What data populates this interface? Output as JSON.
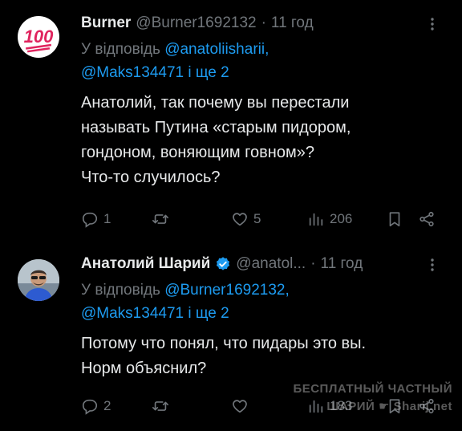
{
  "tweets": [
    {
      "name": "Burner",
      "handle": "@Burner1692132",
      "separator": "·",
      "time": "11 год",
      "avatar_text": "100",
      "reply_prefix": "У відповідь",
      "reply_mention1": "@anatoliisharii,",
      "reply_mention2": "@Maks134471",
      "reply_suffix": "і ще 2",
      "text_lines": [
        "Анатолий, так почему вы перестали",
        "называть Путина «старым пидором,",
        "гондоном, воняющим говном»?",
        "Что-то случилось?"
      ],
      "replies": "1",
      "retweets": "",
      "likes": "5",
      "views": "206"
    },
    {
      "name": "Анатолий Шарий",
      "handle": "@anatol...",
      "separator": "·",
      "time": "11 год",
      "verified": true,
      "reply_prefix": "У відповідь",
      "reply_mention1": "@Burner1692132,",
      "reply_mention2": "@Maks134471",
      "reply_suffix": "і ще 2",
      "text_lines": [
        "Потому что понял, что пидары это вы.",
        "Норм объяснил?"
      ],
      "replies": "2",
      "retweets": "",
      "likes": "",
      "views": "183"
    }
  ],
  "icons": {
    "more": "more-icon",
    "reply": "reply-icon",
    "retweet": "retweet-icon",
    "like": "heart-icon",
    "views": "views-icon",
    "bookmark": "bookmark-icon",
    "share": "share-icon",
    "verified": "verified-badge-icon"
  },
  "colors": {
    "background": "#000000",
    "text": "#e7e9ea",
    "muted": "#71767b",
    "link": "#1d9bf0",
    "verified": "#1d9bf0",
    "hundred_red": "#e0245e"
  },
  "watermark": {
    "line1": "БЕСПЛАТНЫЙ ЧАСТНЫЙ",
    "line2a": "ШАРИЙ",
    "line2b": "Sharij.net"
  }
}
